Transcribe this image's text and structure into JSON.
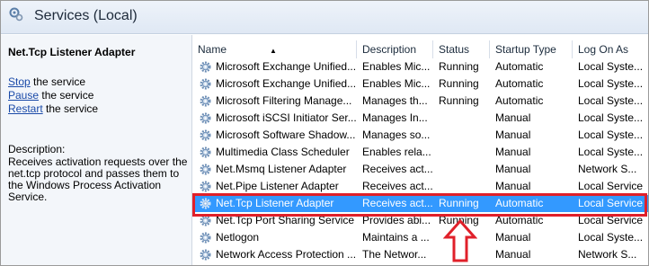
{
  "window": {
    "title": "Services (Local)"
  },
  "left_pane": {
    "service_name": "Net.Tcp Listener Adapter",
    "actions": [
      {
        "link": "Stop",
        "rest": " the service"
      },
      {
        "link": "Pause",
        "rest": " the service"
      },
      {
        "link": "Restart",
        "rest": " the service"
      }
    ],
    "description_label": "Description:",
    "description_lines": [
      "Receives activation requests over the",
      "net.tcp protocol and passes them to",
      "the Windows Process Activation",
      "Service."
    ]
  },
  "columns": [
    "Name",
    "Description",
    "Status",
    "Startup Type",
    "Log On As"
  ],
  "rows": [
    {
      "name": "Microsoft Exchange Unified...",
      "description": "Enables Mic...",
      "status": "Running",
      "startup": "Automatic",
      "logon": "Local Syste..."
    },
    {
      "name": "Microsoft Exchange Unified...",
      "description": "Enables Mic...",
      "status": "Running",
      "startup": "Automatic",
      "logon": "Local Syste..."
    },
    {
      "name": "Microsoft Filtering Manage...",
      "description": "Manages th...",
      "status": "Running",
      "startup": "Automatic",
      "logon": "Local Syste..."
    },
    {
      "name": "Microsoft iSCSI Initiator Ser...",
      "description": "Manages In...",
      "status": "",
      "startup": "Manual",
      "logon": "Local Syste..."
    },
    {
      "name": "Microsoft Software Shadow...",
      "description": "Manages so...",
      "status": "",
      "startup": "Manual",
      "logon": "Local Syste..."
    },
    {
      "name": "Multimedia Class Scheduler",
      "description": "Enables rela...",
      "status": "",
      "startup": "Manual",
      "logon": "Local Syste..."
    },
    {
      "name": "Net.Msmq Listener Adapter",
      "description": "Receives act...",
      "status": "",
      "startup": "Manual",
      "logon": "Network S..."
    },
    {
      "name": "Net.Pipe Listener Adapter",
      "description": "Receives act...",
      "status": "",
      "startup": "Manual",
      "logon": "Local Service"
    },
    {
      "name": "Net.Tcp Listener Adapter",
      "description": "Receives act...",
      "status": "Running",
      "startup": "Automatic",
      "logon": "Local Service",
      "selected": true
    },
    {
      "name": "Net.Tcp Port Sharing Service",
      "description": "Provides abi...",
      "status": "Running",
      "startup": "Automatic",
      "logon": "Local Service"
    },
    {
      "name": "Netlogon",
      "description": "Maintains a ...",
      "status": "",
      "startup": "Manual",
      "logon": "Local Syste..."
    },
    {
      "name": "Network Access Protection ...",
      "description": "The Networ...",
      "status": "",
      "startup": "Manual",
      "logon": "Network S..."
    }
  ],
  "colors": {
    "selection": "#3399ff",
    "highlight": "#e0202a",
    "link": "#1a4aa8"
  },
  "icons": {
    "title": "services-icon",
    "row": "gear-icon",
    "sort": "sort-ascending-icon",
    "annotation": "up-arrow-icon"
  }
}
